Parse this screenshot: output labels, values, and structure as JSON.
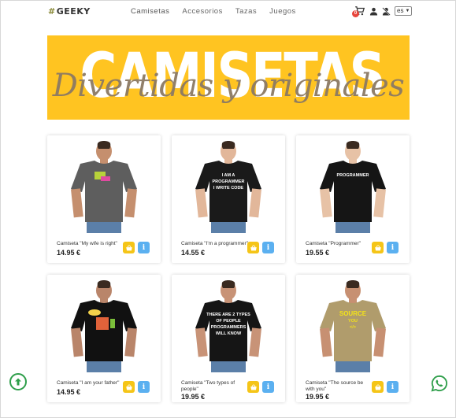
{
  "header": {
    "logo_hash": "#",
    "logo_text": "GEEKY",
    "nav": [
      "Camisetas",
      "Accesorios",
      "Tazas",
      "Juegos"
    ],
    "cart_count": "0",
    "language": "es"
  },
  "banner": {
    "title": "CAMISETAS",
    "subtitle": "Divertidas y originales"
  },
  "products": [
    {
      "name": "Camiseta \"My wife is right\"",
      "price": "14.95 €",
      "shirt_color": "#5e5e5e",
      "skin": "#c58f6e",
      "print": "wife"
    },
    {
      "name": "Camiseta \"I'm a programmer\"",
      "price": "14.55 €",
      "shirt_color": "#1a1a1a",
      "skin": "#e2b79a",
      "print": "iam"
    },
    {
      "name": "Camiseta \"Programmer\"",
      "price": "19.55 €",
      "shirt_color": "#151515",
      "skin": "#e7c2a6",
      "print": "prog"
    },
    {
      "name": "Camiseta \"I am your father\"",
      "price": "14.95 €",
      "shirt_color": "#111111",
      "skin": "#b9856a",
      "print": "father"
    },
    {
      "name": "Camiseta \"Two types of people\"",
      "price": "19.95 €",
      "shirt_color": "#151515",
      "skin": "#c89377",
      "print": "two"
    },
    {
      "name": "Camiseta \"The source be with you\"",
      "price": "19.95 €",
      "shirt_color": "#b09c6c",
      "skin": "#c79072",
      "print": "source"
    }
  ],
  "product_print_text": {
    "iam": [
      "I AM A",
      "PROGRAMMER",
      "I WRITE CODE"
    ],
    "prog": [
      "PROGRAMMER"
    ],
    "father": [],
    "two": [
      "THERE ARE 2 TYPES",
      "OF PEOPLE",
      "PROGRAMMERS",
      "WILL KNOW"
    ],
    "source": [
      "SOURCE",
      "YOU",
      "</>"
    ]
  },
  "colors": {
    "banner": "#ffc421",
    "cart_button": "#f5c518",
    "info_button": "#5bb0f0",
    "back_to_top": "#2e9e4a",
    "whatsapp": "#2e9e4a"
  },
  "icons": {
    "cart_button": "basket-icon",
    "info_button": "info-icon",
    "back_to_top": "arrow-up-circle-icon",
    "whatsapp": "whatsapp-icon"
  }
}
